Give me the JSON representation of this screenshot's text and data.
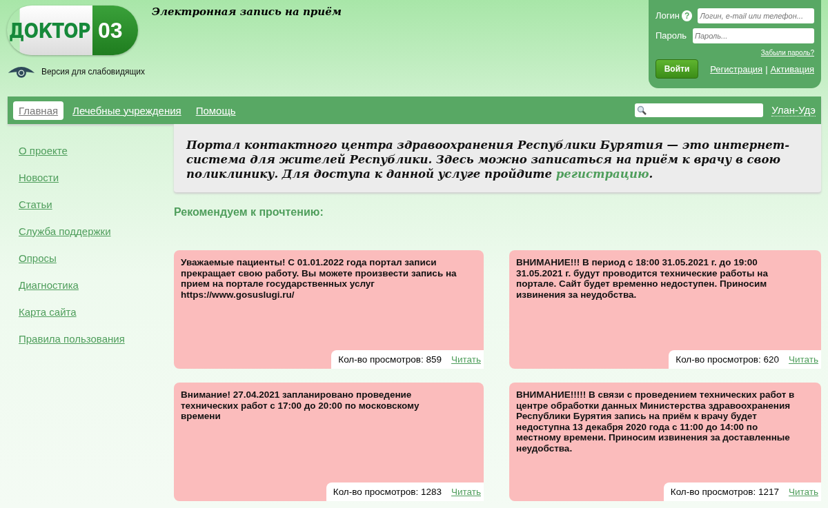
{
  "header": {
    "logo": {
      "word": "ДОКТОР",
      "number": "03"
    },
    "tagline": "Электронная запись на приём",
    "accessibility_link": "Версия для слабовидящих"
  },
  "login": {
    "login_label": "Логин",
    "help": "?",
    "login_placeholder": "Логин, e-mail или телефон...",
    "password_label": "Пароль",
    "password_placeholder": "Пароль...",
    "forgot": "Забыли пароль?",
    "submit": "Войти",
    "register": "Регистрация",
    "separator": "|",
    "activate": "Активация"
  },
  "nav": {
    "items": [
      {
        "label": "Главная",
        "selected": true
      },
      {
        "label": "Лечебные учреждения",
        "selected": false
      },
      {
        "label": "Помощь",
        "selected": false
      }
    ],
    "city": "Улан-Удэ"
  },
  "sidebar": {
    "items": [
      "О проекте",
      "Новости",
      "Статьи",
      "Служба поддержки",
      "Опросы",
      "Диагностика",
      "Карта сайта",
      "Правила пользования"
    ]
  },
  "intro": {
    "text": "Портал контактного центра здравоохранения Республики Бурятия — это интернет-система для жителей Республики. Здесь можно записаться на приём к врачу в свою поликлинику. Для доступа к данной услуге пройдите",
    "link": "регистрацию",
    "after": "."
  },
  "recommended": {
    "title": "Рекомендуем к прочтению:",
    "cards": [
      {
        "text": "Уважаемые пациенты! С 01.01.2022 года портал записи прекращает свою работу. Вы можете произвести запись на прием на портале государственных услуг https://www.gosuslugi.ru/",
        "views": "Кол-во просмотров: 859",
        "read": "Читать"
      },
      {
        "text": "ВНИМАНИЕ!!! В период с 18:00 31.05.2021 г. до 19:00 31.05.2021 г. будут проводится технические работы на портале. Сайт будет временно недоступен. Приносим извинения за неудобства.",
        "views": "Кол-во просмотров: 620",
        "read": "Читать"
      },
      {
        "text": "Внимание! 27.04.2021 запланировано проведение технических работ с 17:00 до 20:00 по московскому времени",
        "views": "Кол-во просмотров: 1283",
        "read": "Читать"
      },
      {
        "text": "ВНИМАНИЕ!!!!! В связи с проведением технических работ в центре обработки данных Министерства здравоохранения Республики Бурятия запись на приём к врачу будет недоступна 13 декабря 2020 года с 11:00 до 14:00 по местному времени. Приносим извинения за доставленные неудобства.",
        "views": "Кол-во просмотров: 1217",
        "read": "Читать"
      }
    ]
  }
}
